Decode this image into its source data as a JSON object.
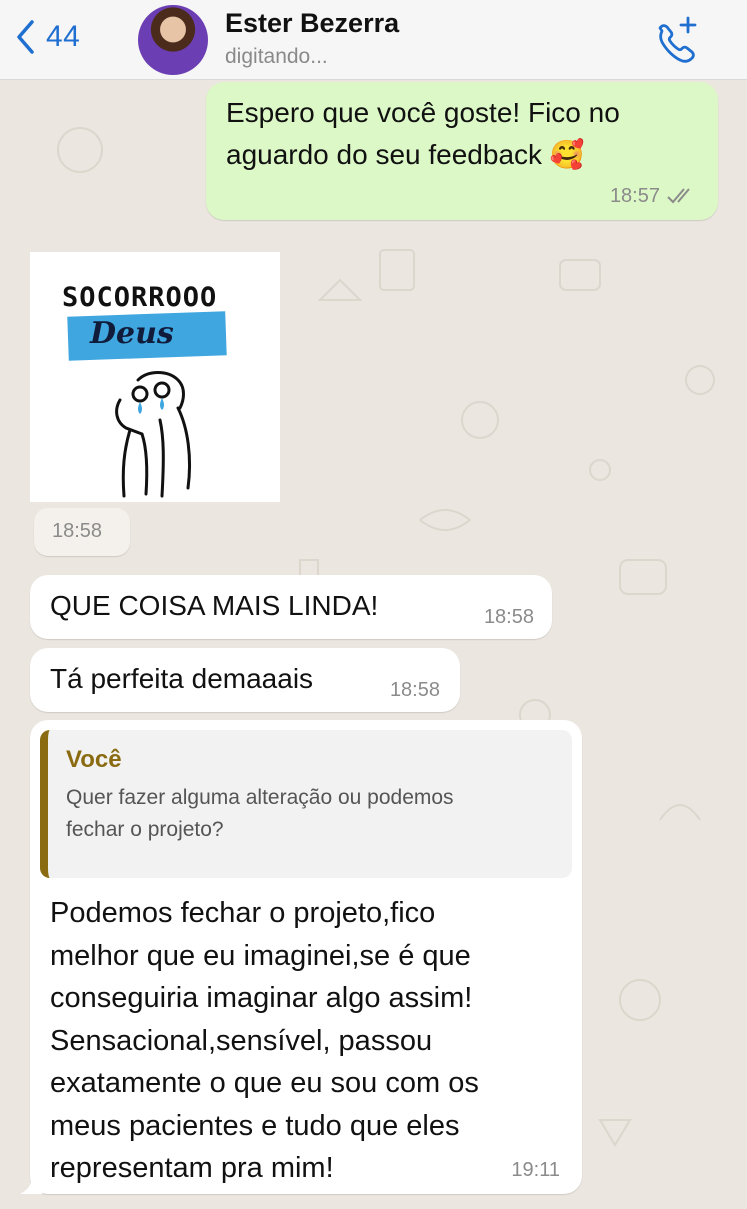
{
  "header": {
    "back_count": "44",
    "contact_name": "Ester Bezerra",
    "status": "digitando...",
    "call_icon": "phone-plus-icon"
  },
  "messages": [
    {
      "direction": "out",
      "text_line1": "Espero que você goste! Fico no",
      "text_line2": "aguardo do seu feedback 🥰",
      "time": "18:57",
      "status_icon": "double-check-icon"
    },
    {
      "direction": "in",
      "type": "sticker",
      "sticker_title": "SOCORROOO",
      "sticker_word": "Deus",
      "time": "18:58"
    },
    {
      "direction": "in",
      "text": "QUE COISA MAIS LINDA!",
      "time": "18:58"
    },
    {
      "direction": "in",
      "text": "Tá perfeita demaaais",
      "time": "18:58"
    },
    {
      "direction": "in",
      "quote_author": "Você",
      "quote_line1": "Quer fazer alguma alteração ou podemos",
      "quote_line2": "fechar o projeto?",
      "lines": [
        "Podemos fechar o projeto,fico",
        "melhor que eu imaginei,se é que",
        "conseguiria imaginar algo assim!",
        "Sensacional,sensível, passou",
        "exatamente o que eu sou com os",
        "meus pacientes e tudo que eles",
        "representam pra mim!"
      ],
      "time": "19:11"
    }
  ],
  "colors": {
    "accent": "#1f6fd1",
    "outgoing_bubble": "#dcf8c6",
    "incoming_bubble": "#ffffff",
    "quote_bar": "#8a6b12",
    "chat_bg": "#ebe6df"
  }
}
